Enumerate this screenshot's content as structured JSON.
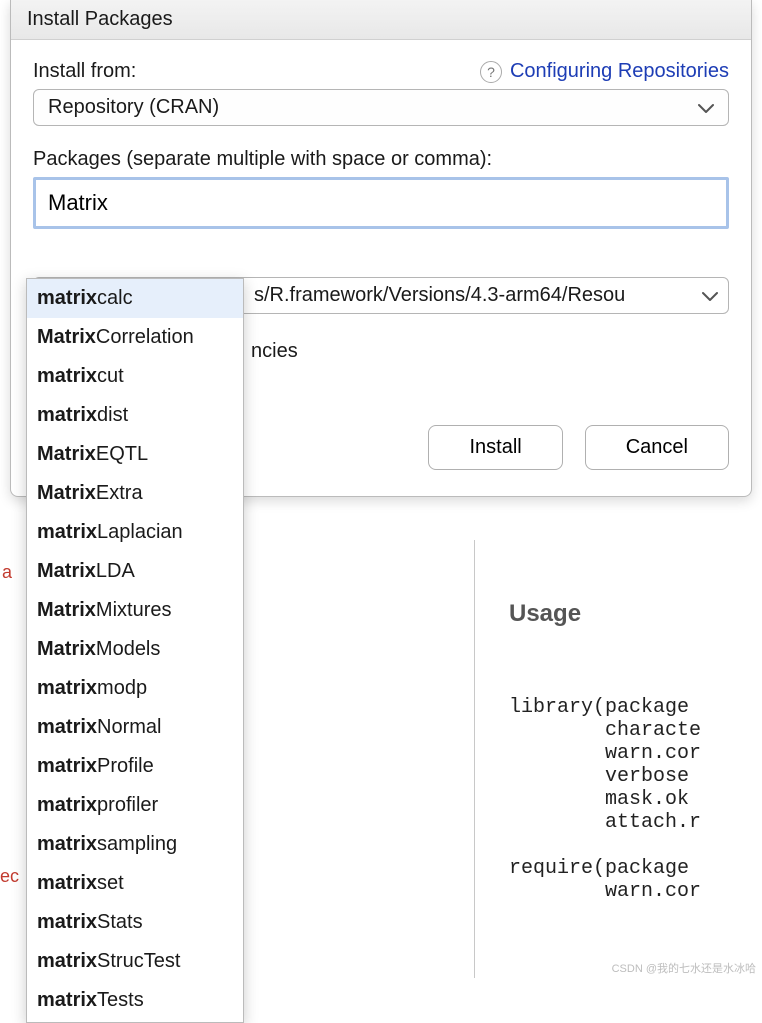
{
  "dialog": {
    "title": "Install Packages",
    "install_from_label": "Install from:",
    "help_link": "Configuring Repositories",
    "repo_select": "Repository (CRAN)",
    "packages_label": "Packages (separate multiple with space or comma):",
    "packages_value": "Matrix",
    "library_value": "s/R.framework/Versions/4.3-arm64/Resou",
    "deps_fragment": "ncies",
    "install_button": "Install",
    "cancel_button": "Cancel"
  },
  "autocomplete": {
    "prefix_match": "Matrix",
    "items": [
      {
        "prefix": "matrix",
        "rest": "calc",
        "selected": true
      },
      {
        "prefix": "Matrix",
        "rest": "Correlation"
      },
      {
        "prefix": "matrix",
        "rest": "cut"
      },
      {
        "prefix": "matrix",
        "rest": "dist"
      },
      {
        "prefix": "Matrix",
        "rest": "EQTL"
      },
      {
        "prefix": "Matrix",
        "rest": "Extra"
      },
      {
        "prefix": "matrix",
        "rest": "Laplacian"
      },
      {
        "prefix": "Matrix",
        "rest": "LDA"
      },
      {
        "prefix": "Matrix",
        "rest": "Mixtures"
      },
      {
        "prefix": "Matrix",
        "rest": "Models"
      },
      {
        "prefix": "matrix",
        "rest": "modp"
      },
      {
        "prefix": "matrix",
        "rest": "Normal"
      },
      {
        "prefix": "matrix",
        "rest": "Profile"
      },
      {
        "prefix": "matrix",
        "rest": "profiler"
      },
      {
        "prefix": "matrix",
        "rest": "sampling"
      },
      {
        "prefix": "matrix",
        "rest": "set"
      },
      {
        "prefix": "matrix",
        "rest": "Stats"
      },
      {
        "prefix": "matrix",
        "rest": "StrucTest"
      },
      {
        "prefix": "matrix",
        "rest": "Tests"
      }
    ]
  },
  "back": {
    "left_frag1": "a",
    "left_frag2": "ec",
    "usage_heading": "Usage",
    "code": "library(package\n        characte\n        warn.cor\n        verbose\n        mask.ok\n        attach.r\n\nrequire(package\n        warn.cor"
  },
  "watermark": "CSDN @我的七水还是水冰哈"
}
